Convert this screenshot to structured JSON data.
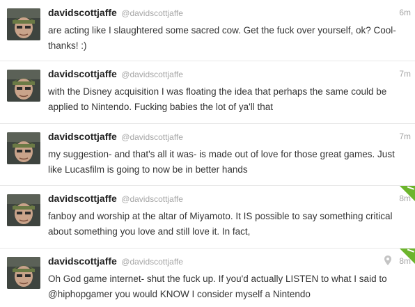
{
  "tweets": [
    {
      "name": "davidscottjaffe",
      "handle": "@davidscottjaffe",
      "time": "6m",
      "text": "are acting like I slaughtered some sacred cow. Get the fuck over yourself, ok? Cool-thanks! :)",
      "favorited": false,
      "geo": false
    },
    {
      "name": "davidscottjaffe",
      "handle": "@davidscottjaffe",
      "time": "7m",
      "text": "with the Disney acquisition I was floating the idea that perhaps the same could be applied to Nintendo. Fucking babies the lot of ya'll that",
      "favorited": false,
      "geo": false
    },
    {
      "name": "davidscottjaffe",
      "handle": "@davidscottjaffe",
      "time": "7m",
      "text": "my suggestion- and that's all it was- is made out of love for those great games. Just like Lucasfilm is going to now be in better hands",
      "favorited": false,
      "geo": false
    },
    {
      "name": "davidscottjaffe",
      "handle": "@davidscottjaffe",
      "time": "8m",
      "text": "fanboy and worship at the altar of Miyamoto. It IS possible to say something critical about something you love and still love it. In fact,",
      "favorited": true,
      "geo": false
    },
    {
      "name": "davidscottjaffe",
      "handle": "@davidscottjaffe",
      "time": "8m",
      "text": "Oh God game internet- shut the fuck up. If you'd actually LISTEN to what I said to @hiphopgamer you would KNOW I consider myself a Nintendo",
      "favorited": true,
      "geo": true
    }
  ],
  "colors": {
    "favorite_corner": "#6cb52c",
    "meta_text": "#a6a6a6",
    "body_text": "#333333"
  },
  "icons": {
    "avatar": "profile-photo",
    "favorite": "favorite-corner-icon",
    "geo": "map-pin-icon"
  }
}
